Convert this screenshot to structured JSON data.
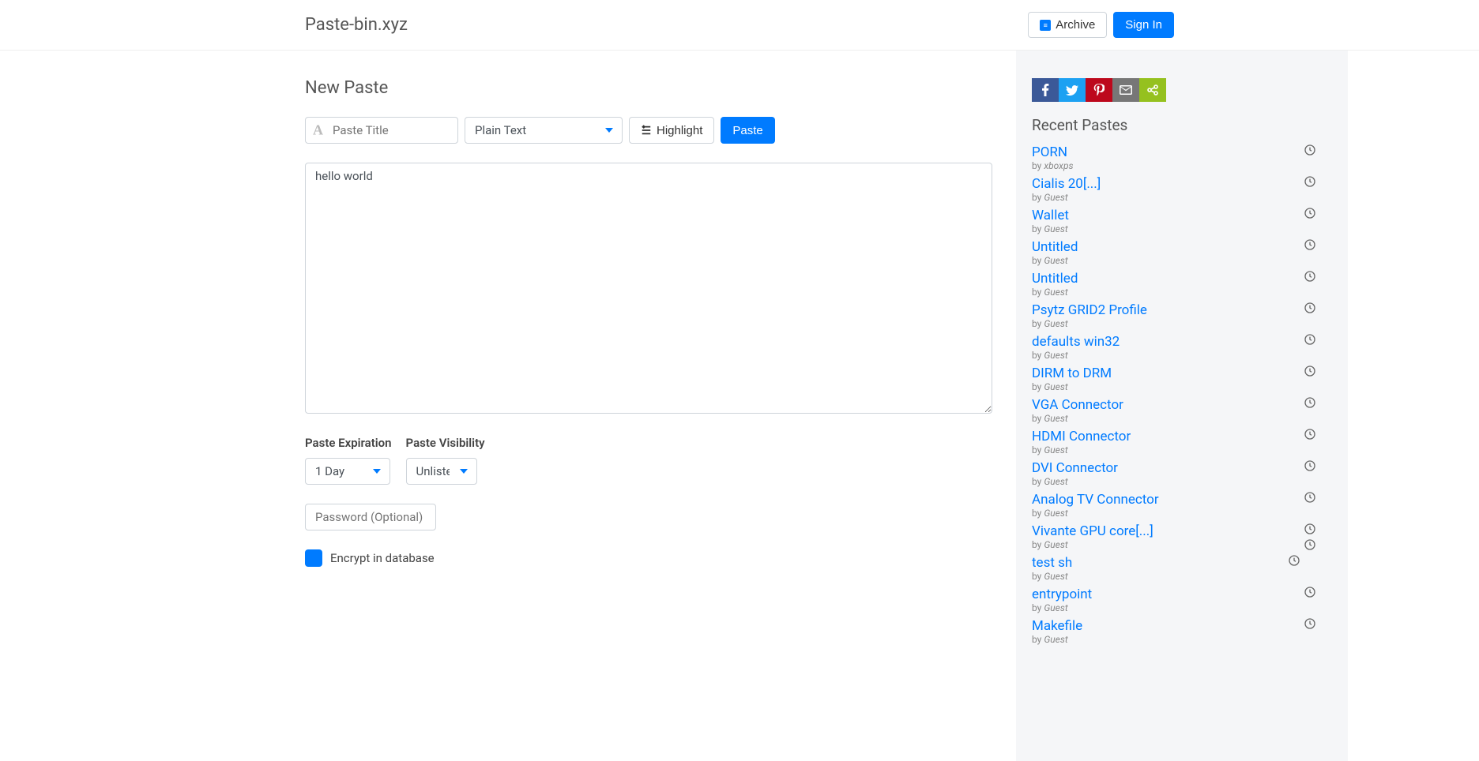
{
  "brand": "Paste-bin.xyz",
  "header": {
    "archive_label": "Archive",
    "signin_label": "Sign In"
  },
  "form": {
    "title": "New Paste",
    "paste_title_placeholder": "Paste Title",
    "syntax_selected": "Plain Text",
    "highlight_label": "Highlight",
    "paste_label": "Paste",
    "textarea_value": "hello world",
    "expiration_label": "Paste Expiration",
    "expiration_selected": "1 Day",
    "visibility_label": "Paste Visibility",
    "visibility_selected": "Unlisted",
    "password_placeholder": "Password (Optional)",
    "encrypt_label": "Encrypt in database"
  },
  "sidebar": {
    "recent_title": "Recent Pastes",
    "by_prefix": "by ",
    "items": [
      {
        "title": "PORN",
        "author": "xboxps"
      },
      {
        "title": "Cialis 20[...]",
        "author": "Guest"
      },
      {
        "title": "Wallet",
        "author": "Guest"
      },
      {
        "title": "Untitled",
        "author": "Guest"
      },
      {
        "title": "Untitled",
        "author": "Guest"
      },
      {
        "title": "Psytz GRID2 Profile",
        "author": "Guest"
      },
      {
        "title": "defaults win32",
        "author": "Guest"
      },
      {
        "title": "DIRM to DRM",
        "author": "Guest"
      },
      {
        "title": "VGA Connector",
        "author": "Guest"
      },
      {
        "title": "HDMI Connector",
        "author": "Guest"
      },
      {
        "title": "DVI Connector",
        "author": "Guest"
      },
      {
        "title": "Analog TV Connector",
        "author": "Guest"
      },
      {
        "title": "Vivante GPU core[...]",
        "author": "Guest",
        "double_clock": true
      },
      {
        "title": "test sh",
        "author": "Guest",
        "clock_offset": true
      },
      {
        "title": "entrypoint",
        "author": "Guest"
      },
      {
        "title": "Makefile",
        "author": "Guest"
      }
    ]
  }
}
